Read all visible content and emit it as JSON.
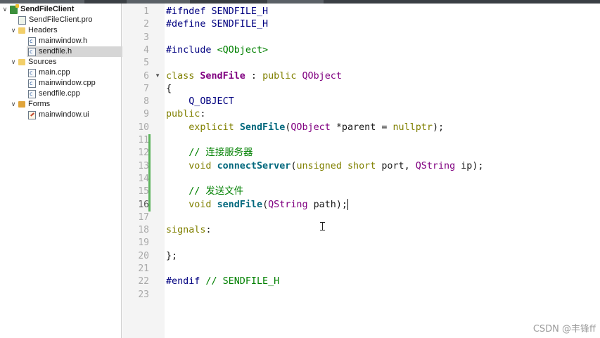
{
  "project_tree": {
    "project": "SendFileClient",
    "pro_file": "SendFileClient.pro",
    "headers_label": "Headers",
    "headers": [
      "mainwindow.h",
      "sendfile.h"
    ],
    "sources_label": "Sources",
    "sources": [
      "main.cpp",
      "mainwindow.cpp",
      "sendfile.cpp"
    ],
    "forms_label": "Forms",
    "forms": [
      "mainwindow.ui"
    ],
    "selected": "sendfile.h"
  },
  "line_numbers": [
    "1",
    "2",
    "3",
    "4",
    "5",
    "6",
    "7",
    "8",
    "9",
    "10",
    "11",
    "12",
    "13",
    "14",
    "15",
    "16",
    "17",
    "18",
    "19",
    "20",
    "21",
    "22",
    "23"
  ],
  "current_line": "16",
  "code": {
    "l1": {
      "a": "#ifndef SENDFILE_H"
    },
    "l2": {
      "a": "#define SENDFILE_H"
    },
    "l4": {
      "a": "#include ",
      "b": "<QObject>"
    },
    "l6": {
      "a": "class",
      "b": " ",
      "c": "SendFile",
      "d": " : ",
      "e": "public",
      "f": " ",
      "g": "QObject"
    },
    "l7": {
      "a": "{"
    },
    "l8": {
      "a": "    Q_OBJECT"
    },
    "l9": {
      "a": "public",
      "b": ":"
    },
    "l10": {
      "a": "    ",
      "b": "explicit",
      "c": " ",
      "d": "SendFile",
      "e": "(",
      "f": "QObject",
      "g": " *parent = ",
      "h": "nullptr",
      "i": ");"
    },
    "l12": {
      "a": "    // 连接服务器"
    },
    "l13": {
      "a": "    ",
      "b": "void",
      "c": " ",
      "d": "connectServer",
      "e": "(",
      "f": "unsigned",
      "g": " ",
      "h": "short",
      "i": " port, ",
      "j": "QString",
      "k": " ip);"
    },
    "l15": {
      "a": "    // 发送文件"
    },
    "l16": {
      "a": "    ",
      "b": "void",
      "c": " ",
      "d": "sendFile",
      "e": "(",
      "f": "QString",
      "g": " path);"
    },
    "l18": {
      "a": "signals",
      "b": ":"
    },
    "l20": {
      "a": "};"
    },
    "l22": {
      "a": "#endif",
      "b": " // SENDFILE_H"
    }
  },
  "watermark": "CSDN @丰锋ff",
  "colors": {
    "keyword": "#808000",
    "preprocessor": "#000080",
    "class": "#800080",
    "function": "#00677c",
    "comment": "#008000",
    "changebar": "#5cb35c"
  }
}
